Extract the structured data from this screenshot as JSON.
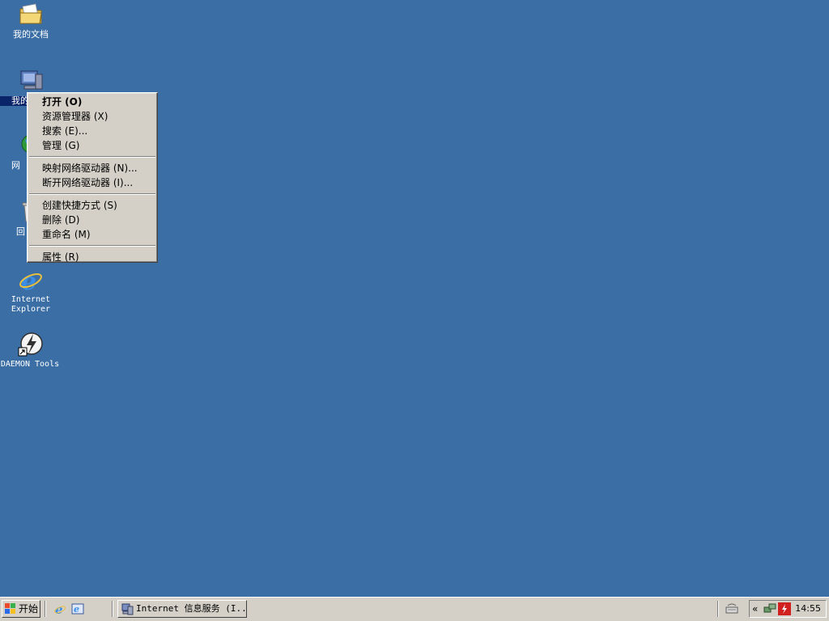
{
  "desktop": {
    "background": "#3a6ea5",
    "icons": [
      {
        "label": "我的文档",
        "icon": "folder-icon"
      },
      {
        "label": "我的",
        "icon": "computer-icon"
      },
      {
        "label": "网",
        "icon": "network-icon"
      },
      {
        "label": "回",
        "icon": "recycle-bin-icon"
      },
      {
        "label": "Internet\nExplorer",
        "icon": "internet-explorer-icon"
      },
      {
        "label": "DAEMON Tools",
        "icon": "daemon-tools-icon"
      }
    ]
  },
  "context_menu": {
    "items": [
      {
        "label": "打开 (O)",
        "bold": true
      },
      {
        "label": "资源管理器 (X)"
      },
      {
        "label": "搜索 (E)..."
      },
      {
        "label": "管理 (G)"
      },
      {
        "label": "映射网络驱动器 (N)..."
      },
      {
        "label": "断开网络驱动器 (I)..."
      },
      {
        "label": "创建快捷方式 (S)"
      },
      {
        "label": "删除 (D)"
      },
      {
        "label": "重命名 (M)"
      },
      {
        "label": "属性 (R)"
      }
    ]
  },
  "taskbar": {
    "start_label": "开始",
    "quick_launch": [
      "internet-explorer-icon",
      "show-desktop-icon"
    ],
    "task_label": "Internet 信息服务 (I...",
    "tray_chevron": "«",
    "clock": "14:55"
  }
}
